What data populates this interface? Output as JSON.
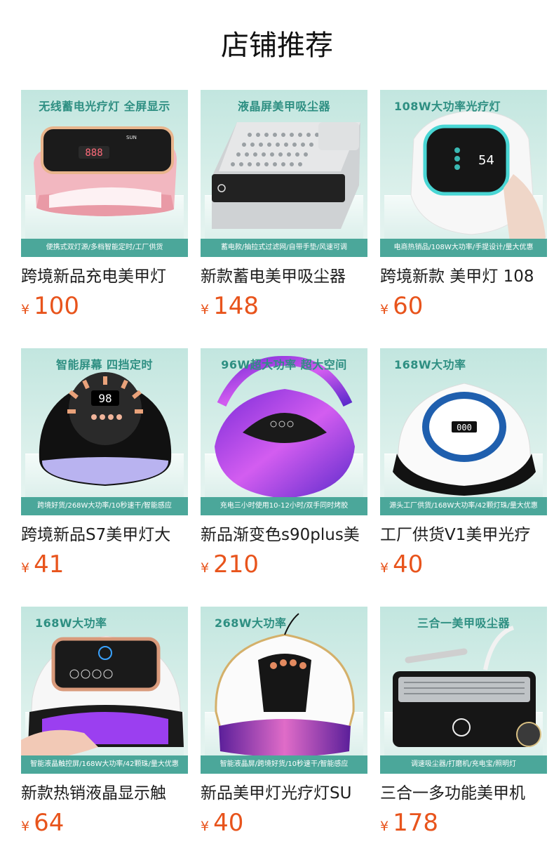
{
  "page": {
    "title": "店铺推荐"
  },
  "colors": {
    "price": "#e8541c",
    "thumb_bg": "#c2e6df",
    "ribbon": "#4ba79a",
    "headline": "#2e8f82"
  },
  "products": [
    {
      "headline": "无线蓄电光疗灯 全屏显示",
      "ribbon": "便携式双灯源/多档智能定时/工厂供货",
      "name": "跨境新品充电美甲灯",
      "currency": "¥",
      "price": "100",
      "art": "pink-nail-lamp"
    },
    {
      "headline": "液晶屏美甲吸尘器",
      "ribbon": "蓄电款/抽拉式过滤网/自带手垫/风速可调",
      "name": "新款蓄电美甲吸尘器",
      "currency": "¥",
      "price": "148",
      "art": "silver-dust-collector"
    },
    {
      "headline": "108W大功率光疗灯",
      "ribbon": "电商热销品/108W大功率/手提设计/量大优惠",
      "name": "跨境新款 美甲灯 108",
      "currency": "¥",
      "price": "60",
      "art": "white-nail-lamp"
    },
    {
      "headline": "智能屏幕 四挡定时",
      "ribbon": "跨境好货/268W大功率/10秒速干/智能感应",
      "name": "跨境新品S7美甲灯大",
      "currency": "¥",
      "price": "41",
      "art": "black-dome-lamp"
    },
    {
      "headline": "96W超大功率 超大空间",
      "ribbon": "充电三小时使用10-12小时/双手同时烤胶",
      "name": "新品渐变色s90plus美",
      "currency": "¥",
      "price": "210",
      "art": "purple-gradient-lamp"
    },
    {
      "headline": "168W大功率",
      "ribbon": "源头工厂供货/168W大功率/42颗灯珠/量大优惠",
      "name": "工厂供货V1美甲光疗",
      "currency": "¥",
      "price": "40",
      "art": "blue-ring-lamp"
    },
    {
      "headline": "168W大功率",
      "ribbon": "智能液晶触控屏/168W大功率/42颗珠/量大优惠",
      "name": "新款热销液晶显示触",
      "currency": "¥",
      "price": "64",
      "art": "hand-nail-lamp"
    },
    {
      "headline": "268W大功率",
      "ribbon": "智能液晶屏/跨境好货/10秒速干/智能感应",
      "name": "新品美甲灯光疗灯SU",
      "currency": "¥",
      "price": "40",
      "art": "gold-white-lamp"
    },
    {
      "headline": "三合一美甲吸尘器",
      "ribbon": "调速吸尘器/打磨机/充电宝/照明灯",
      "name": "三合一多功能美甲机",
      "currency": "¥",
      "price": "178",
      "art": "three-in-one-machine"
    }
  ]
}
